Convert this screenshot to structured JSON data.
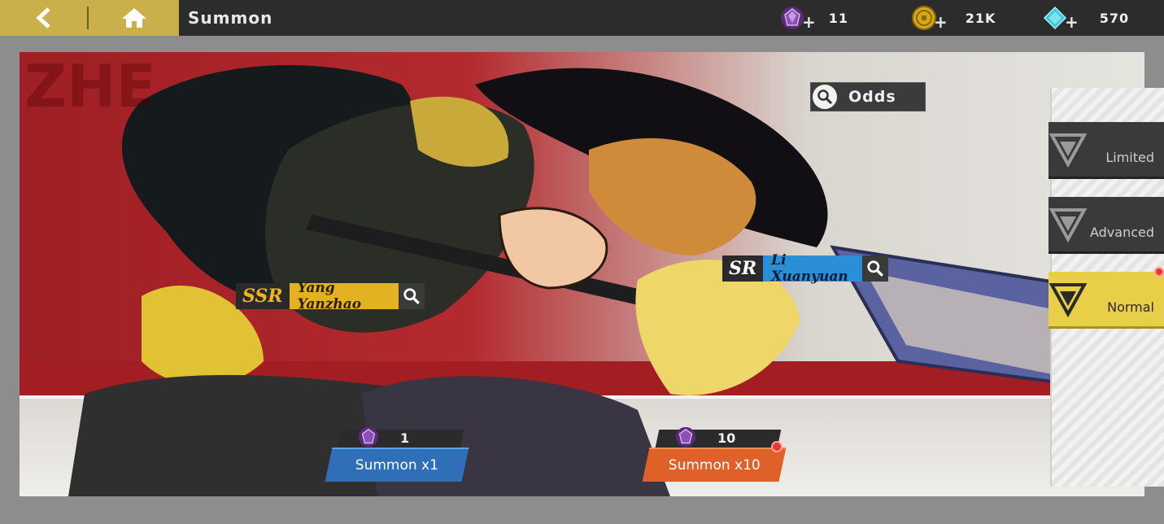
{
  "header": {
    "title": "Summon",
    "back_icon": "back-arrow-icon",
    "home_icon": "home-icon"
  },
  "currencies": [
    {
      "name": "summon-ticket",
      "icon": "purple-gem-icon",
      "amount": "11"
    },
    {
      "name": "gold",
      "icon": "gold-coin-icon",
      "amount": "21K"
    },
    {
      "name": "diamond",
      "icon": "cyan-diamond-icon",
      "amount": "570"
    }
  ],
  "banner": {
    "odds_label": "Odds",
    "heroes": [
      {
        "rarity": "SSR",
        "name": "Yang Yanzhao"
      },
      {
        "rarity": "SR",
        "name": "Li Xuanyuan"
      }
    ]
  },
  "summon_buttons": [
    {
      "label": "Summon x1",
      "cost": "1"
    },
    {
      "label": "Summon x10",
      "cost": "10"
    }
  ],
  "tabs": [
    {
      "label": "Limited"
    },
    {
      "label": "Advanced"
    },
    {
      "label": "Normal"
    }
  ],
  "colors": {
    "accent_gold": "#c9b04a",
    "ssr_gold": "#e3b220",
    "sr_blue": "#2a8fd6",
    "summon1_blue": "#2f6fb8",
    "summon10_orange": "#e0602a",
    "active_tab": "#e9cf48"
  }
}
